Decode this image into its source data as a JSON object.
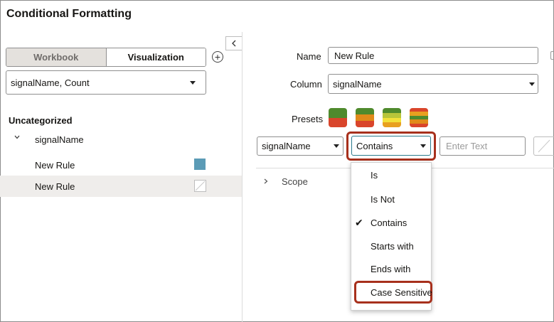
{
  "dialog": {
    "title": "Conditional Formatting"
  },
  "left": {
    "segments": [
      {
        "label": "Workbook",
        "selected": false
      },
      {
        "label": "Visualization",
        "selected": true
      }
    ],
    "dataset_select": {
      "value": "signalName, Count"
    },
    "category": "Uncategorized",
    "tree_node": "signalName",
    "rules": [
      {
        "label": "New Rule",
        "swatch": "#5b9bb6"
      },
      {
        "label": "New Rule",
        "swatch": "none"
      }
    ]
  },
  "form": {
    "name_label": "Name",
    "name_value": "New Rule",
    "column_label": "Column",
    "column_value": "signalName",
    "presets_label": "Presets",
    "presets": [
      [
        "#4f8a2d",
        "#d9452b"
      ],
      [
        "#4f8a2d",
        "#e08a1a",
        "#d9452b"
      ],
      [
        "#4f8a2d",
        "#b7c53a",
        "#f2e13a",
        "#e8a020"
      ],
      [
        "#d9452b",
        "#e8a020",
        "#4f8a2d",
        "#e08a1a",
        "#d9452b"
      ]
    ]
  },
  "condition": {
    "field": "signalName",
    "operator": "Contains",
    "text_placeholder": "Enter Text"
  },
  "operator_menu": {
    "items": [
      {
        "label": "Is",
        "checked": false
      },
      {
        "label": "Is Not",
        "checked": false
      },
      {
        "label": "Contains",
        "checked": true
      },
      {
        "label": "Starts with",
        "checked": false
      },
      {
        "label": "Ends with",
        "checked": false
      },
      {
        "label": "Case Sensitive",
        "checked": false
      }
    ]
  },
  "scope": {
    "label": "Scope"
  },
  "colors": {
    "highlight": "#a7301c",
    "accent": "#2b7a8c"
  }
}
